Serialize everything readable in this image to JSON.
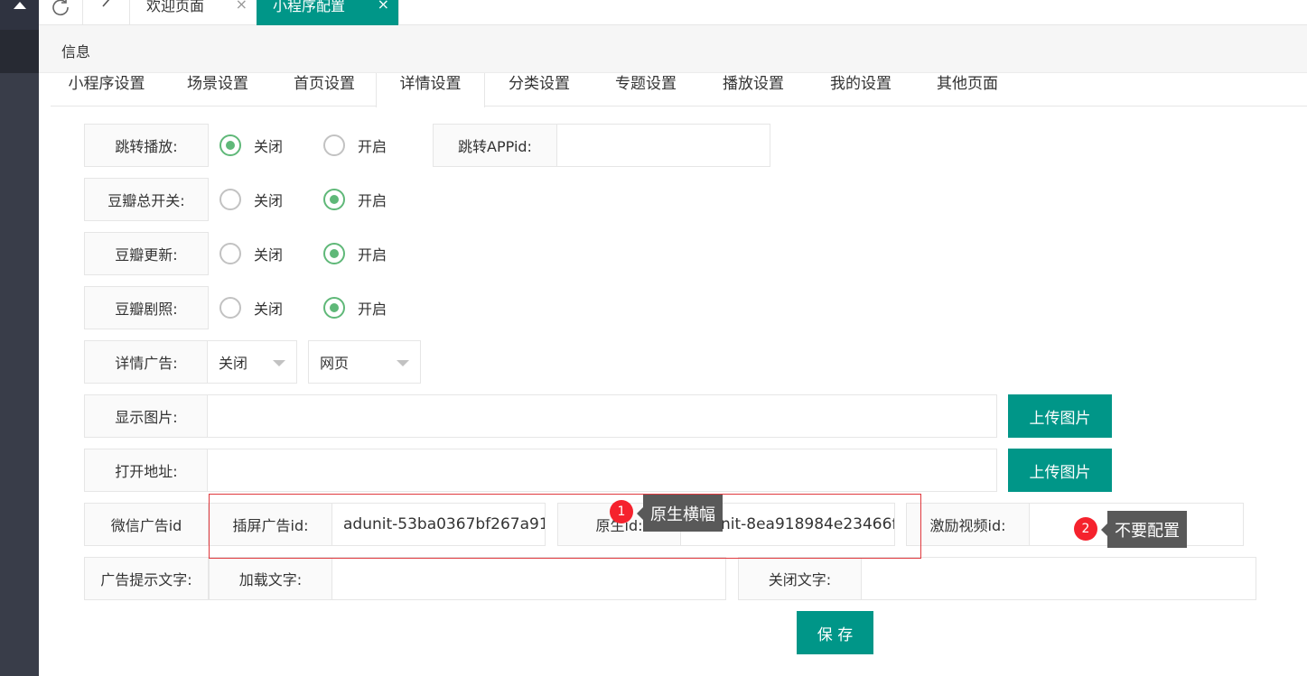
{
  "tabbar": {
    "tabs": [
      {
        "label": "欢迎页面",
        "close": "×"
      },
      {
        "label": "小程序配置",
        "close": "×"
      }
    ]
  },
  "info": {
    "title": "信息"
  },
  "subtabs": [
    "小程序设置",
    "场景设置",
    "首页设置",
    "详情设置",
    "分类设置",
    "专题设置",
    "播放设置",
    "我的设置",
    "其他页面"
  ],
  "form": {
    "jump_play": {
      "label": "跳转播放:",
      "off": "关闭",
      "on": "开启",
      "value": "off"
    },
    "jump_appid": {
      "label": "跳转APPid:",
      "value": ""
    },
    "douban_master": {
      "label": "豆瓣总开关:",
      "off": "关闭",
      "on": "开启",
      "value": "on"
    },
    "douban_update": {
      "label": "豆瓣更新:",
      "off": "关闭",
      "on": "开启",
      "value": "on"
    },
    "douban_stills": {
      "label": "豆瓣剧照:",
      "off": "关闭",
      "on": "开启",
      "value": "on"
    },
    "detail_ad": {
      "label": "详情广告:",
      "select1": "关闭",
      "select2": "网页"
    },
    "show_image": {
      "label": "显示图片:",
      "value": "",
      "button": "上传图片"
    },
    "open_url": {
      "label": "打开地址:",
      "value": "",
      "button": "上传图片"
    },
    "wechat_ad": {
      "label": "微信广告id",
      "interstitial_label": "插屏广告id:",
      "interstitial_value": "adunit-53ba0367bf267a91",
      "native_label": "原生id:",
      "native_value": "adunit-8ea918984e23466f",
      "reward_label": "激励视频id:",
      "reward_value": ""
    },
    "ad_text": {
      "label": "广告提示文字:",
      "loading_label": "加载文字:",
      "loading_value": "",
      "close_label": "关闭文字:",
      "close_value": ""
    },
    "save": "保 存"
  },
  "annotations": [
    {
      "num": "1",
      "text": "原生横幅"
    },
    {
      "num": "2",
      "text": "不要配置"
    }
  ],
  "colors": {
    "primary": "#009688",
    "radio_on": "#5fb878",
    "annotation_border": "#e0393e",
    "badge": "#f5222d",
    "tooltip": "#595959",
    "sidebar": "#393d49"
  },
  "icons": [
    "collapse-arrow-icon",
    "refresh-icon",
    "back-icon",
    "close-icon",
    "dropdown-arrow-icon"
  ]
}
